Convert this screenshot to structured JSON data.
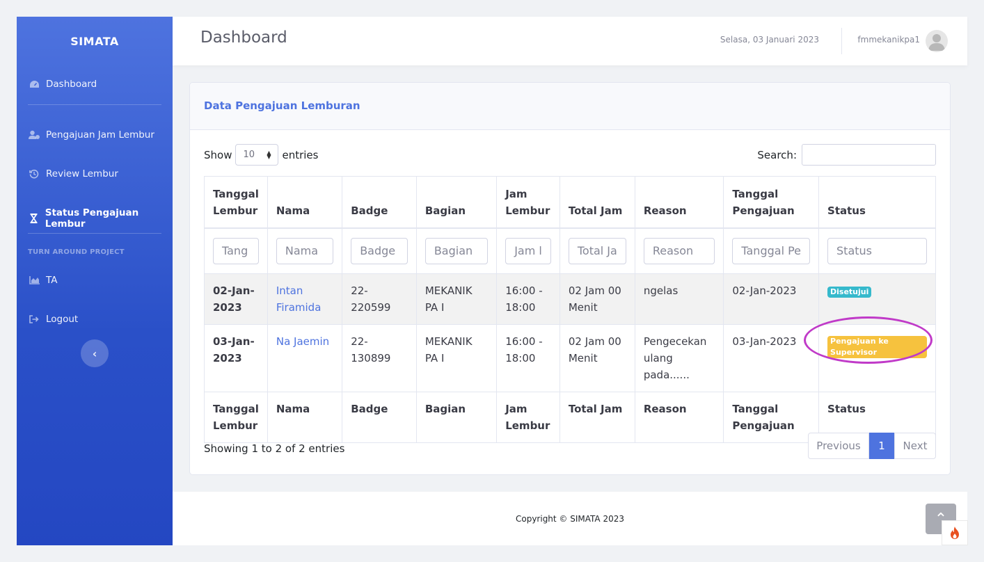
{
  "sidebar": {
    "brand": "SIMATA",
    "items": [
      {
        "label": "Dashboard",
        "icon": "tachometer-icon"
      },
      {
        "label": "Pengajuan Jam Lembur",
        "icon": "user-cog-icon"
      },
      {
        "label": "Review Lembur",
        "icon": "history-icon"
      },
      {
        "label": "Status Pengajuan Lembur",
        "icon": "hourglass-icon",
        "active": true
      },
      {
        "label": "TA",
        "icon": "chart-area-icon"
      },
      {
        "label": "Logout",
        "icon": "sign-out-icon"
      }
    ],
    "section_heading": "TURN AROUND PROJECT"
  },
  "header": {
    "title": "Dashboard",
    "date": "Selasa, 03 Januari 2023",
    "username": "fmmekanikpa1"
  },
  "card": {
    "title": "Data Pengajuan Lemburan",
    "show_label": "Show",
    "entries_label": "entries",
    "page_length": "10",
    "search_label": "Search:",
    "columns": [
      {
        "line1": "Tanggal",
        "line2": "Lembur"
      },
      {
        "line1": "",
        "line2": "Nama"
      },
      {
        "line1": "",
        "line2": "Badge"
      },
      {
        "line1": "",
        "line2": "Bagian"
      },
      {
        "line1": "Jam",
        "line2": "Lembur"
      },
      {
        "line1": "",
        "line2": "Total Jam"
      },
      {
        "line1": "",
        "line2": "Reason"
      },
      {
        "line1": "Tanggal",
        "line2": "Pengajuan"
      },
      {
        "line1": "",
        "line2": "Status"
      }
    ],
    "filter_placeholders": [
      "Tang",
      "Nama",
      "Badge",
      "Bagian",
      "Jam l",
      "Total Ja",
      "Reason",
      "Tanggal Pe",
      "Status"
    ],
    "rows": [
      {
        "tanggal_lembur": "02-Jan-2023",
        "nama": "Intan Firamida",
        "badge": "22-220599",
        "bagian": "MEKANIK PA I",
        "jam_lembur": "16:00 - 18:00",
        "total_jam": "02 Jam 00 Menit",
        "reason": "ngelas",
        "tanggal_pengajuan": "02-Jan-2023",
        "status": "Disetujui",
        "status_color": "#36b9cc"
      },
      {
        "tanggal_lembur": "03-Jan-2023",
        "nama": "Na Jaemin",
        "badge": "22-130899",
        "bagian": "MEKANIK PA I",
        "jam_lembur": "16:00 - 18:00",
        "total_jam": "02 Jam 00 Menit",
        "reason": "Pengecekan ulang pada......",
        "tanggal_pengajuan": "03-Jan-2023",
        "status": "Pengajuan ke Supervisor",
        "status_color": "#f6c23e"
      }
    ],
    "footer_columns": [
      {
        "line1": "Tanggal",
        "line2": "Lembur"
      },
      {
        "line1": "Nama",
        "line2": ""
      },
      {
        "line1": "Badge",
        "line2": ""
      },
      {
        "line1": "Bagian",
        "line2": ""
      },
      {
        "line1": "Jam",
        "line2": "Lembur"
      },
      {
        "line1": "Total Jam",
        "line2": ""
      },
      {
        "line1": "Reason",
        "line2": ""
      },
      {
        "line1": "Tanggal",
        "line2": "Pengajuan"
      },
      {
        "line1": "Status",
        "line2": ""
      }
    ],
    "info": "Showing 1 to 2 of 2 entries",
    "pagination": {
      "previous": "Previous",
      "current": "1",
      "next": "Next"
    }
  },
  "footer": {
    "copyright": "Copyright © SIMATA 2023"
  },
  "colors": {
    "primary": "#4e73df",
    "info": "#36b9cc",
    "warning": "#f6c23e",
    "highlight_circle": "#c03ac8"
  }
}
